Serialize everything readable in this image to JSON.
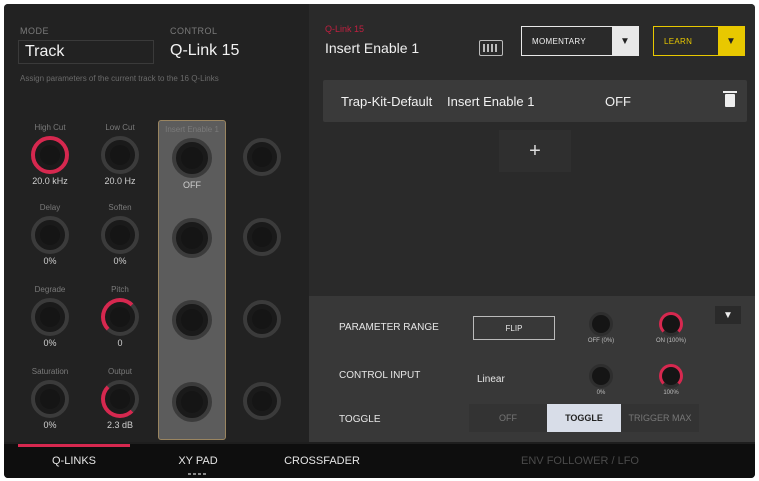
{
  "left": {
    "mode_label": "MODE",
    "mode_value": "Track",
    "control_label": "CONTROL",
    "control_value": "Q-Link 15",
    "hint": "Assign parameters of the current track to the 16 Q-Links",
    "knobs": {
      "high_cut": {
        "label": "High Cut",
        "value": "20.0 kHz"
      },
      "low_cut": {
        "label": "Low Cut",
        "value": "20.0 Hz"
      },
      "insert_enable": {
        "label": "Insert Enable 1",
        "value": "OFF"
      },
      "delay": {
        "label": "Delay",
        "value": "0%"
      },
      "soften": {
        "label": "Soften",
        "value": "0%"
      },
      "degrade": {
        "label": "Degrade",
        "value": "0%"
      },
      "pitch": {
        "label": "Pitch",
        "value": "0"
      },
      "saturation": {
        "label": "Saturation",
        "value": "0%"
      },
      "output": {
        "label": "Output",
        "value": "2.3 dB"
      }
    }
  },
  "right": {
    "qlink_label": "Q-Link 15",
    "qlink_value": "Insert Enable 1",
    "momentary_label": "MOMENTARY",
    "learn_label": "LEARN",
    "assignment": {
      "track": "Trap-Kit-Default",
      "param": "Insert Enable 1",
      "value": "OFF"
    },
    "add_symbol": "+",
    "param_range_label": "PARAMETER RANGE",
    "flip_label": "FLIP",
    "off_knob_label": "OFF (0%)",
    "on_knob_label": "ON (100%)",
    "control_input_label": "CONTROL INPUT",
    "control_input_value": "Linear",
    "ci_min_label": "0%",
    "ci_max_label": "100%",
    "toggle_label": "TOGGLE",
    "toggle_options": [
      "OFF",
      "TOGGLE",
      "TRIGGER MAX"
    ]
  },
  "tabs": [
    "Q-LINKS",
    "XY PAD",
    "CROSSFADER",
    "ENV FOLLOWER / LFO"
  ],
  "colors": {
    "accent": "#d6284f",
    "learn": "#e8c800",
    "highlight": "#5c5c5c"
  }
}
